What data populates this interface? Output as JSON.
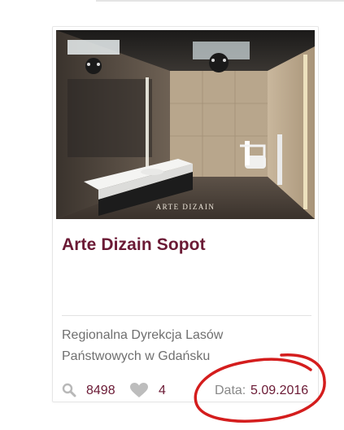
{
  "card": {
    "image": {
      "watermark": "ARTE DIZAIN"
    },
    "title": "Arte Dizain Sopot",
    "organization": "Regionalna Dyrekcja Lasów Państwowych w Gdańsku",
    "stats": {
      "views": "8498",
      "likes": "4",
      "date_label": "Data:",
      "date_value": "5.09.2016"
    }
  },
  "colors": {
    "title": "#6b1a35",
    "accent": "#6b1a35",
    "annotation": "#d41d1d",
    "muted_text": "#6f6f6f"
  },
  "icons": {
    "views": "magnifier-icon",
    "likes": "heart-icon"
  }
}
